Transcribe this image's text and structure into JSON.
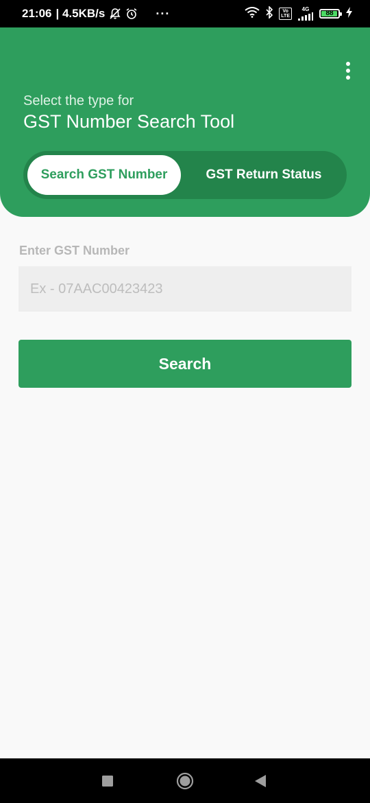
{
  "status_bar": {
    "time": "21:06",
    "speed": "| 4.5KB/s",
    "more_dots": "···",
    "volte": "Vo\nLTE",
    "network": "4G",
    "battery": "88",
    "icons": [
      "mute-bell-icon",
      "alarm-clock-icon",
      "wifi-icon",
      "bluetooth-icon",
      "volte-icon",
      "signal-icon",
      "battery-icon",
      "charging-icon"
    ]
  },
  "header": {
    "subtitle": "Select the type for",
    "title": "GST Number Search Tool",
    "menu_icon": "more-vertical-icon",
    "background_color": "#2e9e5d",
    "tabs": [
      {
        "label": "Search GST Number",
        "active": true
      },
      {
        "label": "GST Return Status",
        "active": false
      }
    ]
  },
  "form": {
    "label": "Enter GST Number",
    "input_value": "",
    "input_placeholder": "Ex - 07AAC00423423",
    "button_label": "Search"
  },
  "nav_bar": {
    "buttons": [
      "recents-square-icon",
      "home-circle-icon",
      "back-triangle-icon"
    ]
  },
  "colors": {
    "accent": "#2e9e5d",
    "accent_dark": "#23844b",
    "background": "#f9f9f9",
    "input_bg": "#eeeeee",
    "label_gray": "#b7b7b7"
  }
}
